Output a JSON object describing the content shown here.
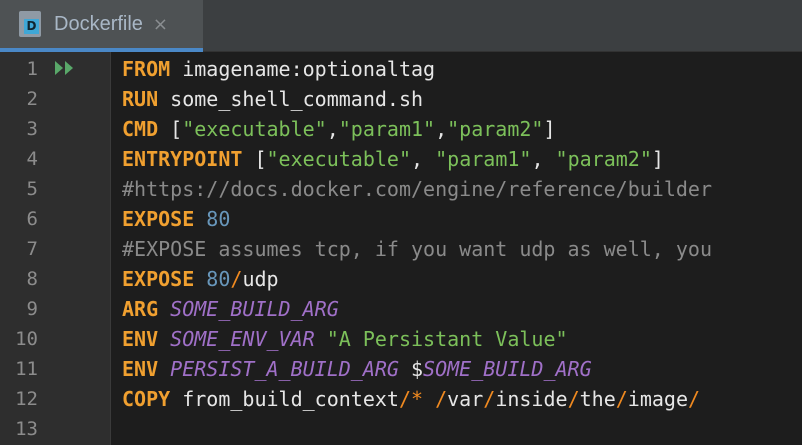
{
  "tab": {
    "title": "Dockerfile",
    "icon_letter": "D",
    "close": "×"
  },
  "line_numbers": [
    "1",
    "2",
    "3",
    "4",
    "5",
    "6",
    "7",
    "8",
    "9",
    "10",
    "11",
    "12",
    "13"
  ],
  "lines": [
    [
      {
        "t": "kw",
        "v": "FROM"
      },
      {
        "t": "plain",
        "v": " imagename:optionaltag"
      }
    ],
    [
      {
        "t": "kw",
        "v": "RUN"
      },
      {
        "t": "plain",
        "v": " some_shell_command.sh"
      }
    ],
    [
      {
        "t": "kw",
        "v": "CMD"
      },
      {
        "t": "plain",
        "v": " ["
      },
      {
        "t": "str",
        "v": "\"executable\""
      },
      {
        "t": "plain",
        "v": ","
      },
      {
        "t": "str",
        "v": "\"param1\""
      },
      {
        "t": "plain",
        "v": ","
      },
      {
        "t": "str",
        "v": "\"param2\""
      },
      {
        "t": "plain",
        "v": "]"
      }
    ],
    [
      {
        "t": "kw",
        "v": "ENTRYPOINT"
      },
      {
        "t": "plain",
        "v": " ["
      },
      {
        "t": "str",
        "v": "\"executable\""
      },
      {
        "t": "plain",
        "v": ", "
      },
      {
        "t": "str",
        "v": "\"param1\""
      },
      {
        "t": "plain",
        "v": ", "
      },
      {
        "t": "str",
        "v": "\"param2\""
      },
      {
        "t": "plain",
        "v": "]"
      }
    ],
    [
      {
        "t": "cmt",
        "v": "#https://docs.docker.com/engine/reference/builder"
      }
    ],
    [
      {
        "t": "kw",
        "v": "EXPOSE"
      },
      {
        "t": "plain",
        "v": " "
      },
      {
        "t": "num",
        "v": "80"
      }
    ],
    [
      {
        "t": "cmt",
        "v": "#EXPOSE assumes tcp, if you want udp as well, you"
      }
    ],
    [
      {
        "t": "kw",
        "v": "EXPOSE"
      },
      {
        "t": "plain",
        "v": " "
      },
      {
        "t": "num",
        "v": "80"
      },
      {
        "t": "slash",
        "v": "/"
      },
      {
        "t": "plain",
        "v": "udp"
      }
    ],
    [
      {
        "t": "kw",
        "v": "ARG"
      },
      {
        "t": "plain",
        "v": " "
      },
      {
        "t": "var",
        "v": "SOME_BUILD_ARG"
      }
    ],
    [
      {
        "t": "kw",
        "v": "ENV"
      },
      {
        "t": "plain",
        "v": " "
      },
      {
        "t": "var",
        "v": "SOME_ENV_VAR"
      },
      {
        "t": "plain",
        "v": " "
      },
      {
        "t": "str",
        "v": "\"A Persistant Value\""
      }
    ],
    [
      {
        "t": "kw",
        "v": "ENV"
      },
      {
        "t": "plain",
        "v": " "
      },
      {
        "t": "var",
        "v": "PERSIST_A_BUILD_ARG"
      },
      {
        "t": "plain",
        "v": " $"
      },
      {
        "t": "var",
        "v": "SOME_BUILD_ARG"
      }
    ],
    [
      {
        "t": "kw",
        "v": "COPY"
      },
      {
        "t": "plain",
        "v": " from_build_context"
      },
      {
        "t": "slash",
        "v": "/*"
      },
      {
        "t": "plain",
        "v": " "
      },
      {
        "t": "slash",
        "v": "/"
      },
      {
        "t": "plain",
        "v": "var"
      },
      {
        "t": "slash",
        "v": "/"
      },
      {
        "t": "plain",
        "v": "inside"
      },
      {
        "t": "slash",
        "v": "/"
      },
      {
        "t": "plain",
        "v": "the"
      },
      {
        "t": "slash",
        "v": "/"
      },
      {
        "t": "plain",
        "v": "image"
      },
      {
        "t": "slash",
        "v": "/"
      }
    ],
    []
  ],
  "colors": {
    "keyword": "#f0a030",
    "string": "#7cc05a",
    "number": "#6897bb",
    "variable": "#a070c8",
    "comment": "#8a8a8a",
    "run_icon": "#59a869",
    "tab_underline": "#4a88c7"
  },
  "icons": {
    "file": "dockerfile-icon",
    "run": "run-gutter-icon",
    "close": "close-icon"
  }
}
